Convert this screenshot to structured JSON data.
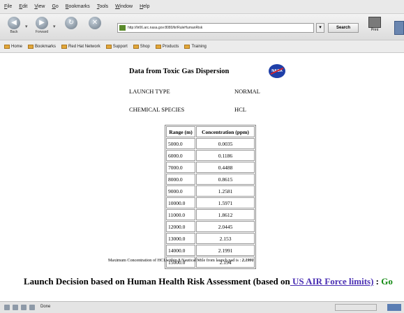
{
  "browser": {
    "menu": [
      "File",
      "Edit",
      "View",
      "Go",
      "Bookmarks",
      "Tools",
      "Window",
      "Help"
    ],
    "back_label": "Back",
    "forward_label": "Forward",
    "url": "http://lir06.arc.nasa.gov:8080/lir/RuleHumanRisk",
    "search_label": "Search",
    "print_label": "Print",
    "bookmarks": [
      "Home",
      "Bookmarks",
      "Red Hat Network",
      "Support",
      "Shop",
      "Products",
      "Training"
    ],
    "status": "Done"
  },
  "page": {
    "title": "Data from Toxic Gas Dispersion",
    "logo_text": "NASA",
    "launch_type_label": "LAUNCH TYPE",
    "launch_type_value": "NORMAL",
    "chemical_label": "CHEMICAL SPECIES",
    "chemical_value": "HCL",
    "table": {
      "headers": [
        "Range (m)",
        "Concentration (ppm)"
      ],
      "rows": [
        [
          "5000.0",
          "0.0035"
        ],
        [
          "6000.0",
          "0.1186"
        ],
        [
          "7000.0",
          "0.4488"
        ],
        [
          "8000.0",
          "0.8615"
        ],
        [
          "9000.0",
          "1.2581"
        ],
        [
          "10000.0",
          "1.5971"
        ],
        [
          "11000.0",
          "1.8612"
        ],
        [
          "12000.0",
          "2.0445"
        ],
        [
          "13000.0",
          "2.153"
        ],
        [
          "14000.0",
          "2.1991"
        ],
        [
          "15000.0",
          "2.194"
        ]
      ]
    },
    "max_text": "Maximum Concentration of HCLwithin 8 Nautical Mile from launch pad is :",
    "max_value": "2.1991",
    "decision_text": "Launch Decision based on Human Health Risk Assessment (based on",
    "decision_link": " US AIR Force limits)",
    "decision_sep": " : ",
    "decision_result": "Go"
  }
}
